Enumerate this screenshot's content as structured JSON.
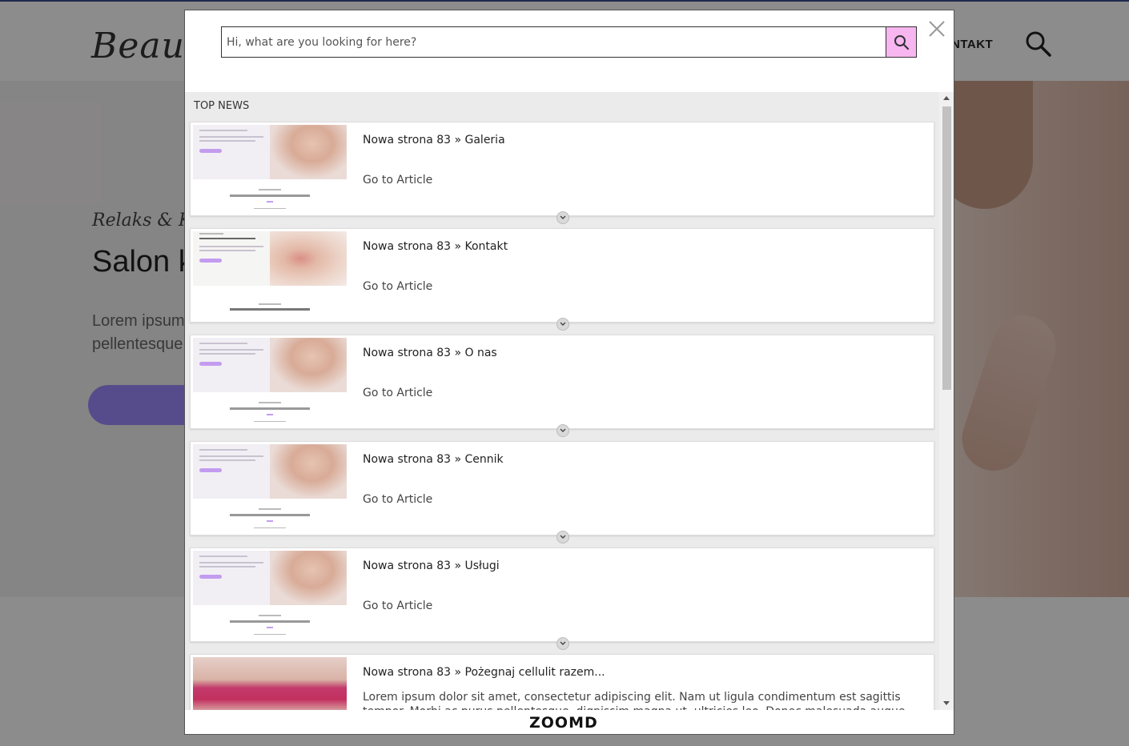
{
  "background_page": {
    "logo": "Beauty",
    "nav_item": "NTAKT",
    "hero": {
      "tagline": "Relaks & K",
      "title": "Salon k",
      "text": "Lorem ipsum pellentesque"
    }
  },
  "search": {
    "placeholder": "Hi, what are you looking for here?",
    "value": "",
    "button_icon": "search-icon",
    "accent_color": "#f7b6f0"
  },
  "close_icon": "close-icon",
  "results": {
    "section_title": "TOP NEWS",
    "items": [
      {
        "title": "Nowa strona 83 » Galeria",
        "link": "Go to Article",
        "thumb": "beauty-page-thumbnail"
      },
      {
        "title": "Nowa strona 83 » Kontakt",
        "link": "Go to Article",
        "thumb": "lips-page-thumbnail"
      },
      {
        "title": "Nowa strona 83 » O nas",
        "link": "Go to Article",
        "thumb": "beauty-page-thumbnail"
      },
      {
        "title": "Nowa strona 83 » Cennik",
        "link": "Go to Article",
        "thumb": "beauty-page-thumbnail"
      },
      {
        "title": "Nowa strona 83 » Usługi",
        "link": "Go to Article",
        "thumb": "beauty-page-thumbnail"
      },
      {
        "title": "Nowa strona 83 » Pożegnaj cellulit razem...",
        "description": "Lorem ipsum dolor sit amet, consectetur adipiscing elit. Nam ut ligula condimentum est sagittis tempor. Morbi ac purus pellentesque, dignissim magna ut, ultricies leo. Donec malesuada augue eget lectus",
        "thumb": "cellulite-thumbnail"
      }
    ]
  },
  "footer": {
    "brand": "ZOOMD"
  }
}
